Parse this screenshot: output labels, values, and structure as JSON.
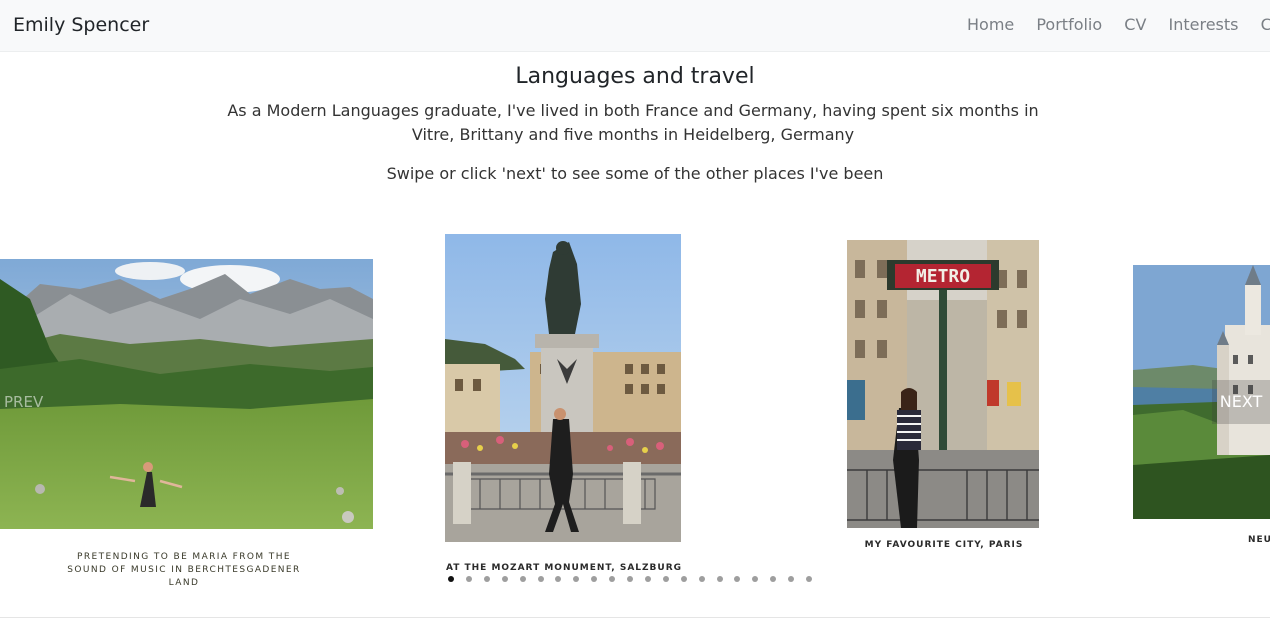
{
  "navbar": {
    "brand": "Emily Spencer",
    "links": [
      "Home",
      "Portfolio",
      "CV",
      "Interests",
      "Contact"
    ]
  },
  "main": {
    "heading": "Languages and travel",
    "intro": "As a Modern Languages graduate, I've lived in both France and Germany, having spent six months in Vitre, Brittany and five months in Heidelberg, Germany",
    "hint": "Swipe or click 'next' to see some of the other places I've been"
  },
  "carousel": {
    "prev_label": "PREV",
    "next_label": "NEXT",
    "slides": [
      {
        "caption": "Pretending to be Maria from the Sound of Music in Berchtesgadener Land",
        "image": "alpine-meadow-photo"
      },
      {
        "caption": "At the Mozart monument, Salzburg",
        "image": "mozart-statue-photo"
      },
      {
        "caption": "My favourite city, Paris",
        "image": "paris-metro-photo"
      },
      {
        "caption": "Neu",
        "image": "neuschwanstein-photo"
      }
    ],
    "dot_count": 21,
    "active_dot": 0
  },
  "colors": {
    "navbar_bg": "#f8f9fa",
    "nav_link": "#7a7f85",
    "active_dot": "#111111",
    "inactive_dot": "#9e9e9e"
  }
}
